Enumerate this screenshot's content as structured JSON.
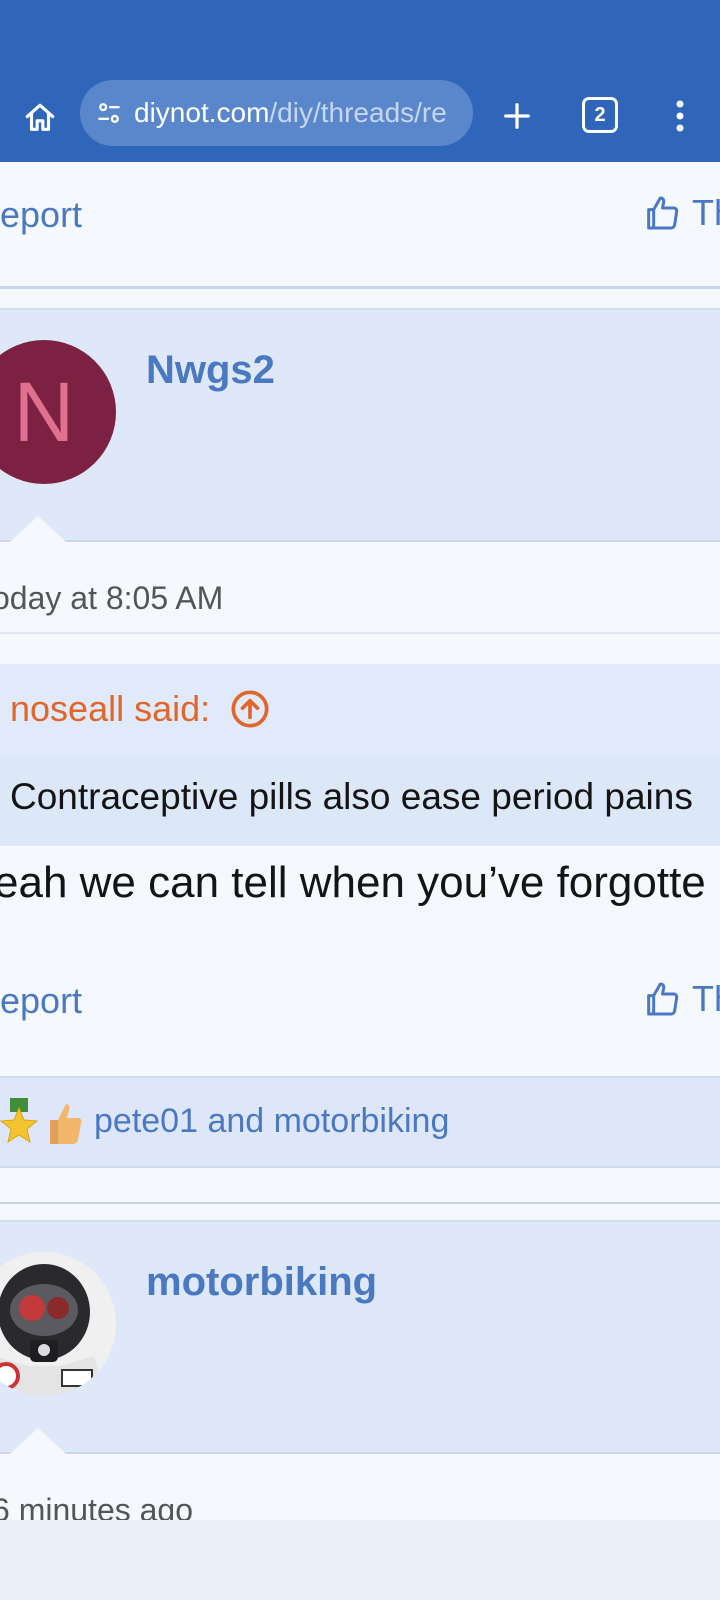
{
  "browser": {
    "url_domain": "diynot.com",
    "url_path": "/diy/threads/re",
    "tab_count": "2"
  },
  "post_top": {
    "report_label": "eport",
    "thanks_label": "Th"
  },
  "post1": {
    "username": "Nwgs2",
    "avatar_letter": "N",
    "timestamp": "oday at 8:05 AM",
    "quote_author": "noseall said:",
    "quote_text": "Contraceptive pills also ease period pains",
    "message": "eah we can tell when you’ve forgotte",
    "report_label": "eport",
    "thanks_label": "Th",
    "reaction_users": "pete01 and motorbiking"
  },
  "post2": {
    "username": "motorbiking",
    "timestamp": "6 minutes ago"
  },
  "colors": {
    "brand_blue": "#3066b9",
    "link_blue": "#4a79c2",
    "quote_orange": "#e0662a",
    "avatar_maroon": "#7d2142"
  }
}
